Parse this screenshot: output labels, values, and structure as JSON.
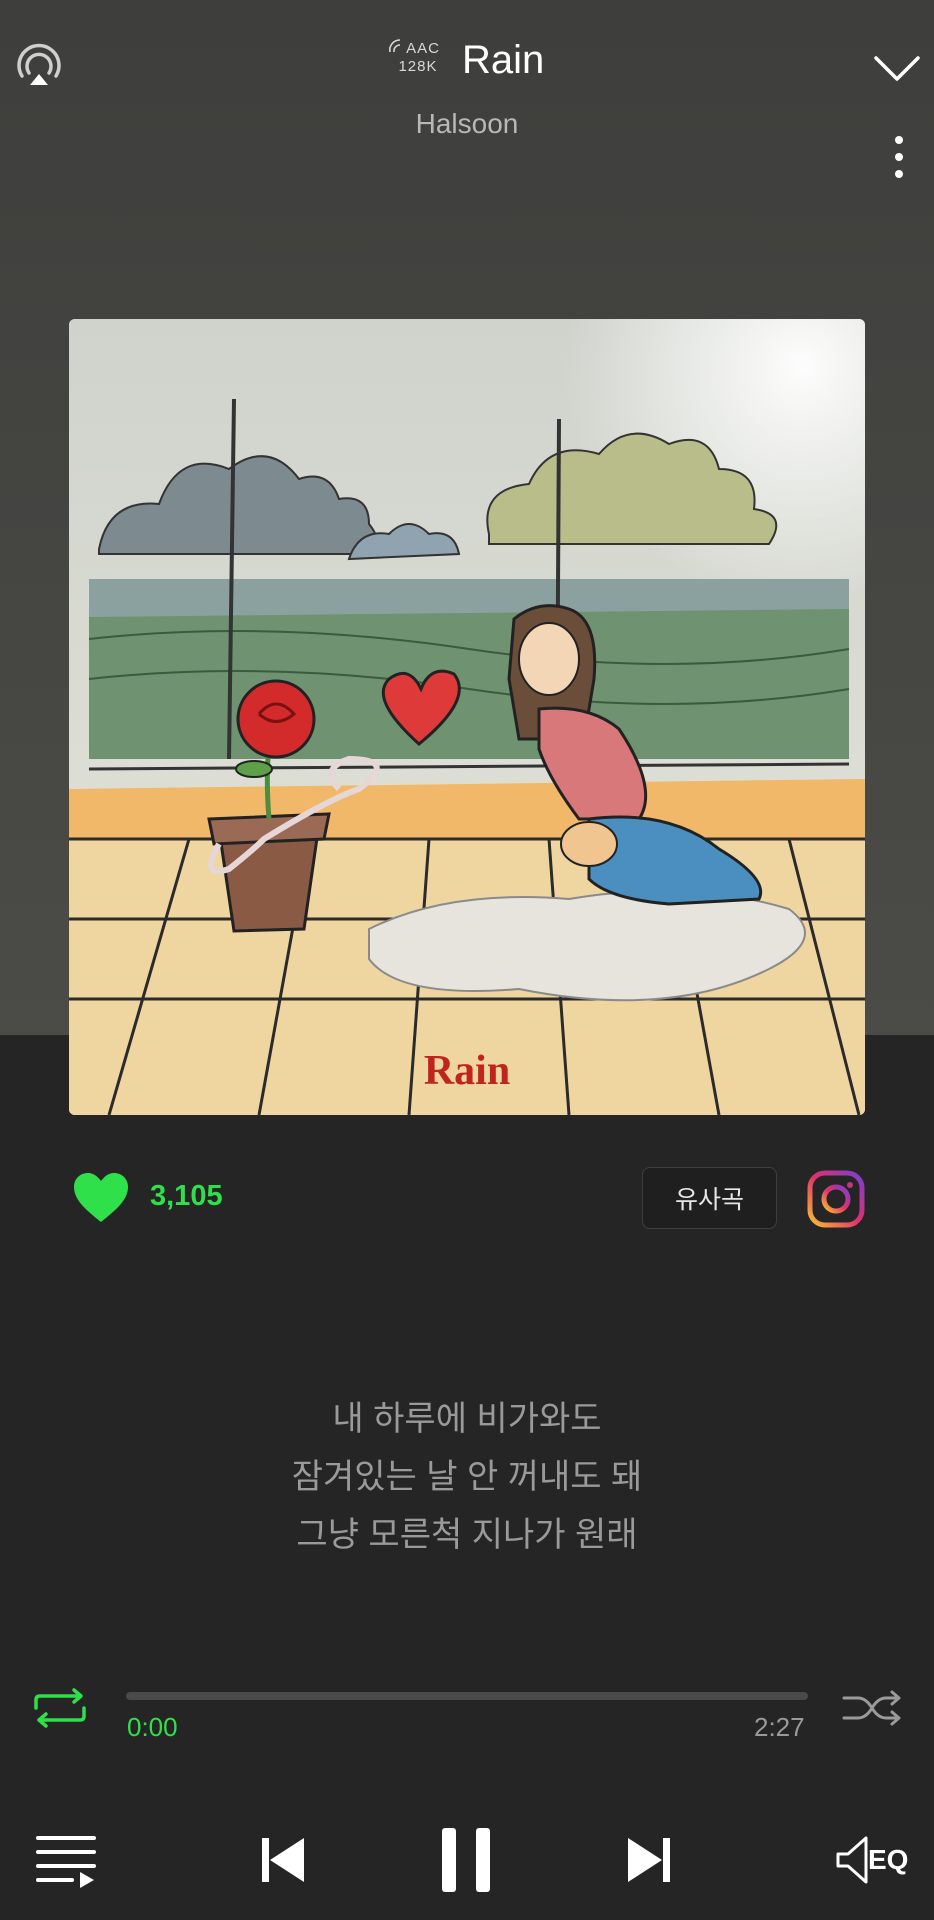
{
  "header": {
    "codec_line1": "AAC",
    "codec_line2": "128K",
    "title": "Rain",
    "artist": "Halsoon"
  },
  "album": {
    "cover_text": "Rain"
  },
  "actions": {
    "like_count": "3,105",
    "similar_label": "유사곡"
  },
  "lyrics": [
    "내 하루에 비가와도",
    "잠겨있는 날 안 꺼내도 돼",
    "그냥 모른척 지나가 원래"
  ],
  "progress": {
    "current_time": "0:00",
    "total_time": "2:27",
    "fraction": 0.0
  },
  "controls": {
    "eq_label": "EQ"
  },
  "colors": {
    "accent": "#2fe04a",
    "background": "#252525"
  }
}
